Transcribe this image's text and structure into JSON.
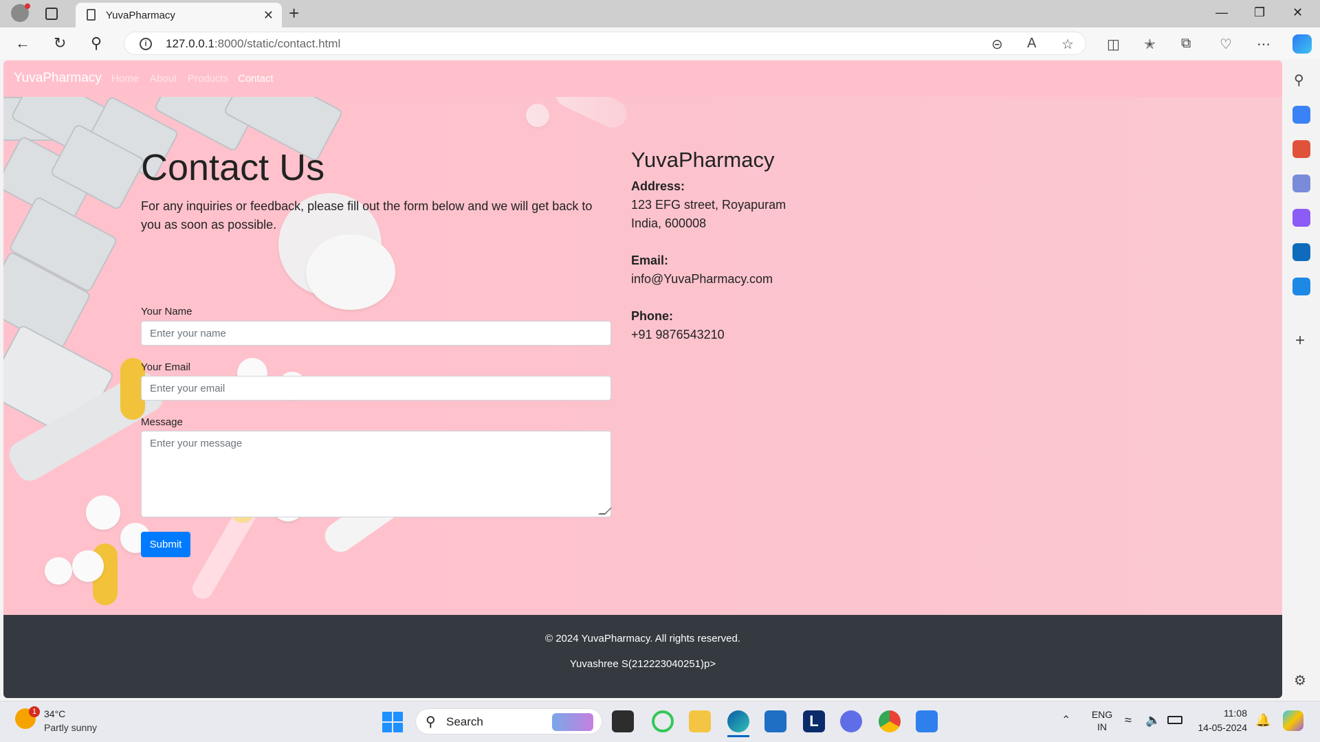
{
  "browser": {
    "tab_title": "YuvaPharmacy",
    "url_host": "127.0.0.1",
    "url_path": ":8000/static/contact.html",
    "new_tab": "+",
    "close_tab": "✕"
  },
  "navbar": {
    "brand": "YuvaPharmacy",
    "links": [
      "Home",
      "About",
      "Products",
      "Contact"
    ],
    "active": "Contact"
  },
  "contact": {
    "title": "Contact Us",
    "description": "For any inquiries or feedback, please fill out the form below and we will get back to you as soon as possible.",
    "name_label": "Your Name",
    "name_placeholder": "Enter your name",
    "email_label": "Your Email",
    "email_placeholder": "Enter your email",
    "message_label": "Message",
    "message_placeholder": "Enter your message",
    "submit_label": "Submit"
  },
  "info": {
    "title": "YuvaPharmacy",
    "address_heading": "Address:",
    "address_line1": "123 EFG street, Royapuram",
    "address_line2": "India, 600008",
    "email_heading": "Email:",
    "email": "info@YuvaPharmacy.com",
    "phone_heading": "Phone:",
    "phone": "+91 9876543210"
  },
  "footer": {
    "copyright": "© 2024 YuvaPharmacy. All rights reserved.",
    "author": "Yuvashree S(212223040251)p>"
  },
  "taskbar": {
    "weather_temp": "34°C",
    "weather_desc": "Partly sunny",
    "weather_badge": "1",
    "search_label": "Search",
    "lang_line1": "ENG",
    "lang_line2": "IN",
    "time": "11:08",
    "date": "14-05-2024"
  },
  "colors": {
    "navbar_bg": "#ffc0cb",
    "submit_bg": "#007bff",
    "footer_bg": "#343a40"
  }
}
